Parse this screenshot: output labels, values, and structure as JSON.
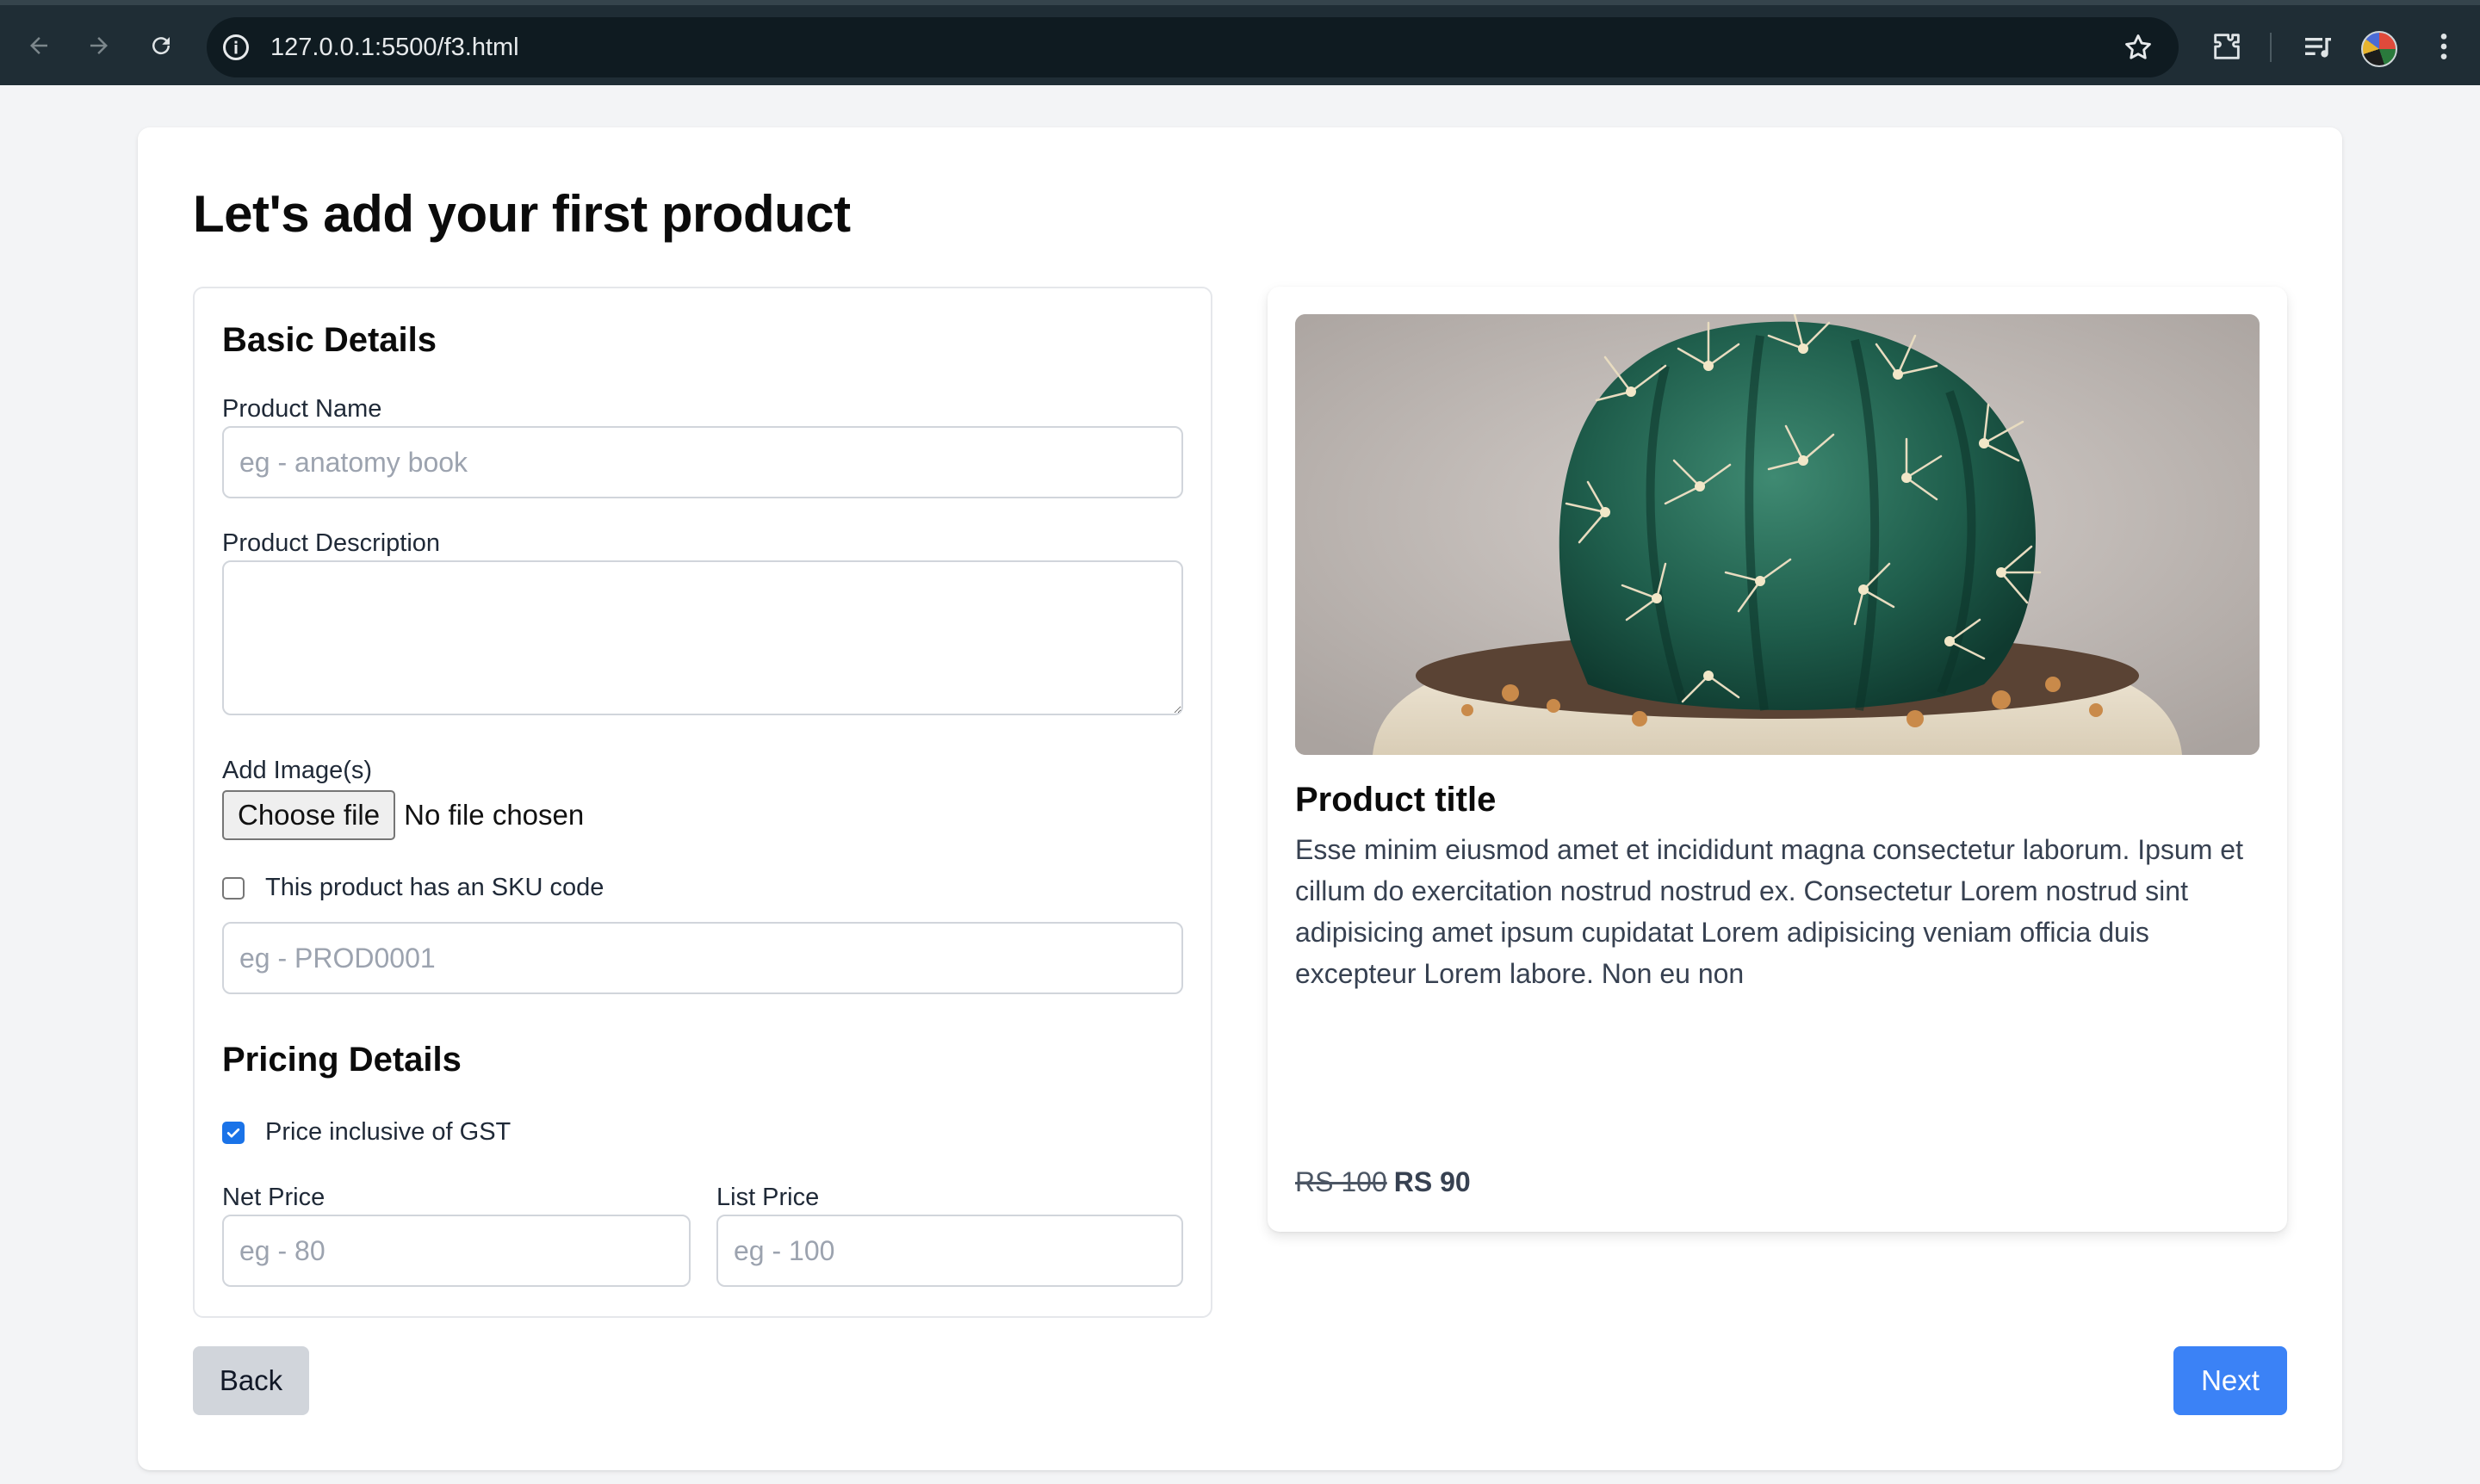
{
  "browser": {
    "url": "127.0.0.1:5500/f3.html",
    "icons": [
      "back-arrow-icon",
      "forward-arrow-icon",
      "reload-icon",
      "site-info-icon",
      "bookmark-star-icon",
      "extensions-icon",
      "media-controls-icon",
      "more-menu-icon"
    ]
  },
  "page": {
    "title": "Let's add your first product"
  },
  "form": {
    "basic_section_title": "Basic Details",
    "product_name": {
      "label": "Product Name",
      "placeholder": "eg - anatomy book",
      "value": ""
    },
    "product_description": {
      "label": "Product Description",
      "value": ""
    },
    "images": {
      "label": "Add Image(s)",
      "button_label": "Choose file",
      "status": "No file chosen"
    },
    "sku": {
      "checkbox_label": "This product has an SKU code",
      "checked": false,
      "placeholder": "eg - PROD0001"
    },
    "pricing_section_title": "Pricing Details",
    "gst": {
      "checkbox_label": "Price inclusive of GST",
      "checked": true
    },
    "net_price": {
      "label": "Net Price",
      "placeholder": "eg - 80"
    },
    "list_price": {
      "label": "List Price",
      "placeholder": "eg - 100"
    }
  },
  "preview": {
    "image_subject": "cactus-in-pot",
    "title": "Product title",
    "description": "Esse minim eiusmod amet et incididunt magna consectetur laborum. Ipsum et cillum do exercitation nostrud nostrud ex. Consectetur Lorem nostrud sint adipisicing amet ipsum cupidatat Lorem adipisicing veniam officia duis excepteur Lorem labore. Non eu non",
    "price_old": "RS 100",
    "price_new": "RS 90"
  },
  "actions": {
    "back_label": "Back",
    "next_label": "Next"
  },
  "colors": {
    "primary": "#3b82f6",
    "secondary": "#d1d5db",
    "background": "#f3f4f6",
    "chrome": "#1f2d35"
  }
}
